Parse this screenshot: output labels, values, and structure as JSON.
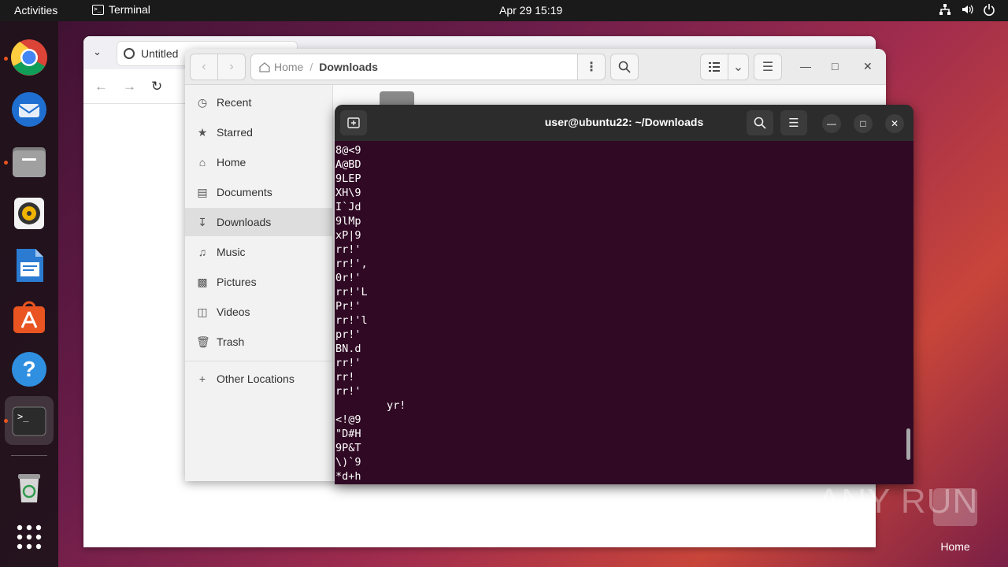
{
  "topbar": {
    "activities": "Activities",
    "app_name": "Terminal",
    "clock": "Apr 29  15:19"
  },
  "dock": {
    "items": [
      {
        "name": "chrome",
        "icon": "chrome-icon",
        "running": true
      },
      {
        "name": "thunderbird",
        "icon": "thunderbird-icon",
        "running": false
      },
      {
        "name": "files",
        "icon": "files-icon",
        "running": true
      },
      {
        "name": "rhythmbox",
        "icon": "rhythmbox-icon",
        "running": false
      },
      {
        "name": "libreoffice-writer",
        "icon": "writer-icon",
        "running": false
      },
      {
        "name": "app-center",
        "icon": "app-center-icon",
        "running": false
      },
      {
        "name": "help",
        "icon": "help-icon",
        "running": false
      },
      {
        "name": "terminal",
        "icon": "terminal-icon",
        "running": true
      },
      {
        "name": "trash",
        "icon": "trash-icon",
        "running": false
      },
      {
        "name": "show-apps",
        "icon": "grid-icon",
        "running": false
      }
    ]
  },
  "browser": {
    "tab_title": "Untitled"
  },
  "files": {
    "path": {
      "home": "Home",
      "current": "Downloads"
    },
    "sidebar": [
      {
        "label": "Recent",
        "icon": "clock-icon"
      },
      {
        "label": "Starred",
        "icon": "star-icon"
      },
      {
        "label": "Home",
        "icon": "home-icon"
      },
      {
        "label": "Documents",
        "icon": "document-icon"
      },
      {
        "label": "Downloads",
        "icon": "download-icon",
        "active": true
      },
      {
        "label": "Music",
        "icon": "music-icon"
      },
      {
        "label": "Pictures",
        "icon": "picture-icon"
      },
      {
        "label": "Videos",
        "icon": "video-icon"
      },
      {
        "label": "Trash",
        "icon": "trash-icon"
      }
    ],
    "other_locations": "Other Locations"
  },
  "terminal": {
    "title": "user@ubuntu22: ~/Downloads",
    "lines": [
      "8@<9",
      "A@BD",
      "9LEP",
      "XH\\9",
      "I`Jd",
      "9lMp",
      "xP|9",
      "rr!'",
      "rr!',",
      "0r!'",
      "rr!'L",
      "Pr!'",
      "rr!'l",
      "pr!'",
      "BN.d",
      "rr!'",
      "rr!",
      "rr!'",
      "        yr!",
      "<!@9",
      "\"D#H",
      "9P&T",
      "\\)`9",
      "*d+h"
    ]
  },
  "desktop": {
    "home_label": "Home",
    "watermark": "ANY RUN"
  },
  "colors": {
    "terminal_bg": "#300a24",
    "accent": "#e95420"
  }
}
